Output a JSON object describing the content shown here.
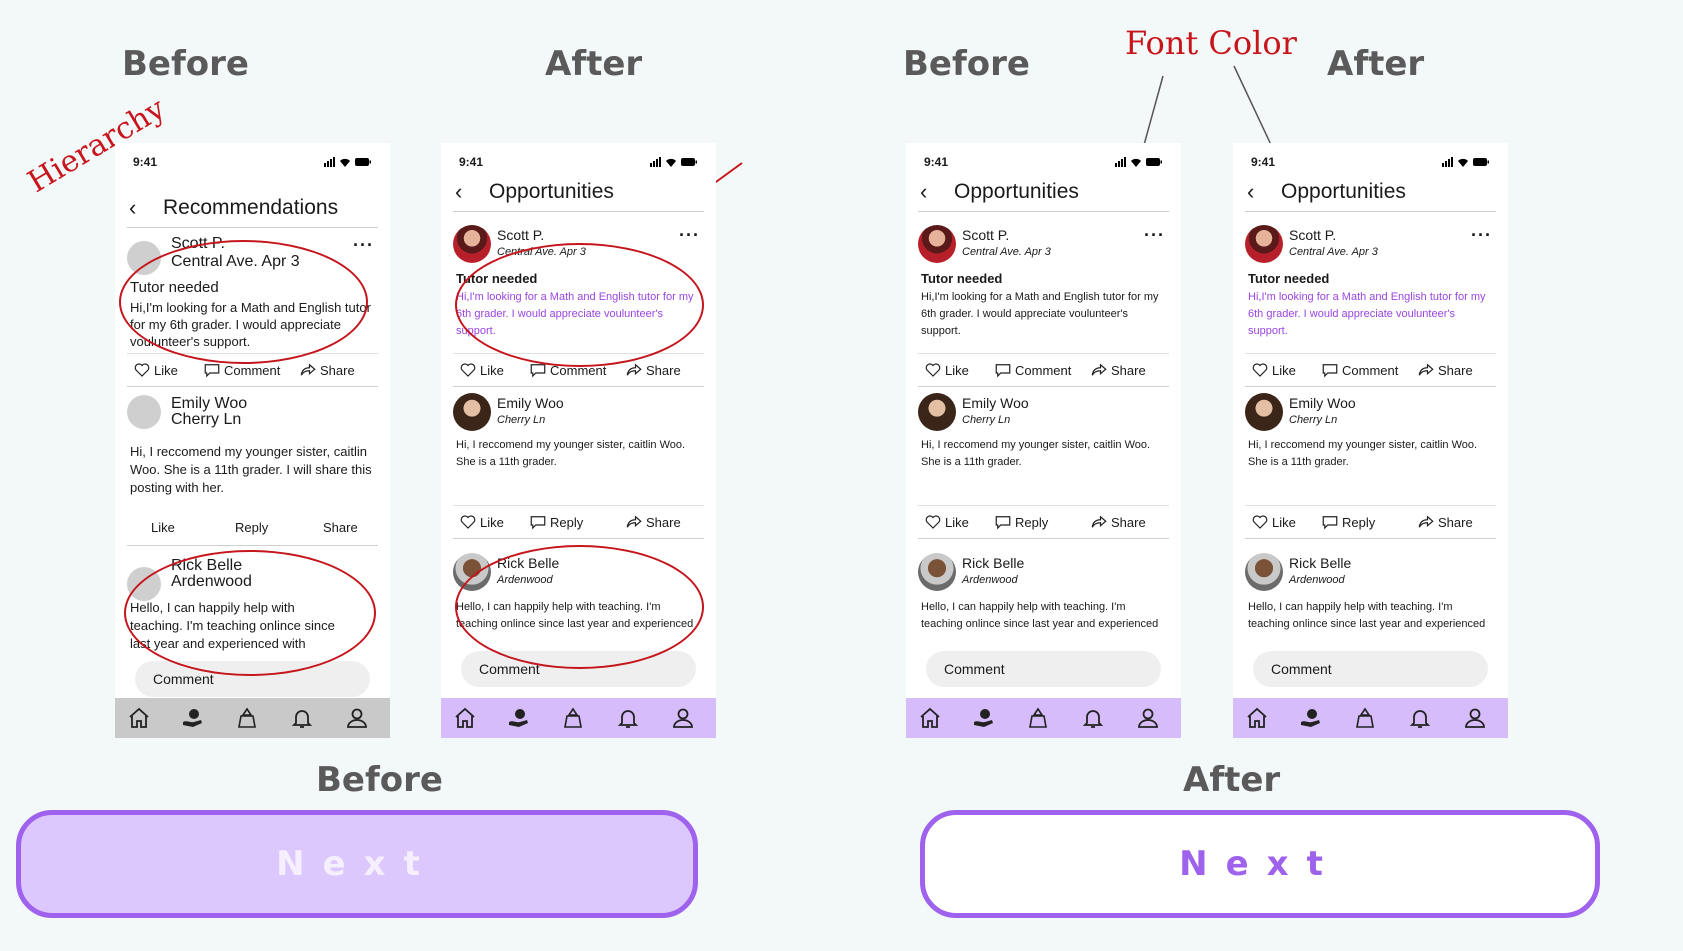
{
  "headers": {
    "top_before_1": "Before",
    "top_after_1": "After",
    "top_before_2": "Before",
    "top_after_2": "After",
    "bottom_before": "Before",
    "bottom_after": "After"
  },
  "annotations": {
    "hierarchy": "Hierarchy",
    "font_color": "Font Color"
  },
  "phones": [
    {
      "time": "9:41",
      "title": "Recommendations",
      "posts": [
        {
          "name": "Scott P.",
          "loc": "Central Ave. Apr 3",
          "title": "Tutor needed",
          "body": "Hi,I'm looking for a Math and English tutor for my 6th grader. I would appreciate voulunteer's support."
        },
        {
          "name": "Emily Woo",
          "loc": "Cherry Ln",
          "body": "Hi, I reccomend my younger sister, caitlin Woo. She is a 11th grader. I will share this posting with her."
        },
        {
          "name": "Rick Belle",
          "loc": "Ardenwood",
          "body": "Hello, I can happily help with teaching. I'm teaching onlince since last year and experienced with"
        }
      ],
      "actions1": [
        "Like",
        "Comment",
        "Share"
      ],
      "actions2": [
        "Like",
        "Reply",
        "Share"
      ],
      "comment_placeholder": "Comment"
    },
    {
      "time": "9:41",
      "title": "Opportunities",
      "posts": [
        {
          "name": "Scott P.",
          "loc": "Central Ave. Apr 3",
          "title": "Tutor needed",
          "body": "Hi,I'm looking for a Math and English tutor for my 6th grader. I would appreciate voulunteer's support."
        },
        {
          "name": "Emily Woo",
          "loc": "Cherry Ln",
          "body": "Hi, I reccomend my younger sister, caitlin Woo. She is a 11th grader."
        },
        {
          "name": "Rick Belle",
          "loc": "Ardenwood",
          "body": "Hello, I can happily help with teaching. I'm teaching onlince since last year and experienced"
        }
      ],
      "actions1": [
        "Like",
        "Comment",
        "Share"
      ],
      "actions2": [
        "Like",
        "Reply",
        "Share"
      ],
      "comment_placeholder": "Comment"
    },
    {
      "time": "9:41",
      "title": "Opportunities",
      "posts": [
        {
          "name": "Scott P.",
          "loc": "Central Ave. Apr 3",
          "title": "Tutor needed",
          "body": "Hi,I'm looking for a Math and English tutor for my 6th grader. I would appreciate voulunteer's support."
        },
        {
          "name": "Emily Woo",
          "loc": "Cherry Ln",
          "body": "Hi, I reccomend my younger sister, caitlin Woo. She is a 11th grader."
        },
        {
          "name": "Rick Belle",
          "loc": "Ardenwood",
          "body": "Hello, I can happily help with teaching. I'm teaching onlince since last year and experienced"
        }
      ],
      "actions1": [
        "Like",
        "Comment",
        "Share"
      ],
      "actions2": [
        "Like",
        "Reply",
        "Share"
      ],
      "comment_placeholder": "Comment"
    },
    {
      "time": "9:41",
      "title": "Opportunities",
      "posts": [
        {
          "name": "Scott P.",
          "loc": "Central Ave. Apr 3",
          "title": "Tutor needed",
          "body": "Hi,I'm looking for a Math and English tutor for my 6th grader. I would appreciate voulunteer's support."
        },
        {
          "name": "Emily Woo",
          "loc": "Cherry Ln",
          "body": "Hi, I reccomend my younger sister, caitlin Woo. She is a 11th grader."
        },
        {
          "name": "Rick Belle",
          "loc": "Ardenwood",
          "body": "Hello, I can happily help with teaching. I'm teaching onlince since last year and experienced"
        }
      ],
      "actions1": [
        "Like",
        "Comment",
        "Share"
      ],
      "actions2": [
        "Like",
        "Reply",
        "Share"
      ],
      "comment_placeholder": "Comment"
    }
  ],
  "buttons": {
    "before_label": "Next",
    "after_label": "Next"
  },
  "colors": {
    "accent": "#9f62ec",
    "tabbar_after": "#d6bcfa",
    "tabbar_before": "#c9c9c9",
    "button_before_fill": "#dcc8fc",
    "annotation_red": "#c8151b"
  },
  "icons": [
    "home-icon",
    "volunteer-icon",
    "donate-icon",
    "bell-icon",
    "profile-icon",
    "heart-icon",
    "comment-icon",
    "share-icon",
    "back-icon",
    "more-icon"
  ]
}
